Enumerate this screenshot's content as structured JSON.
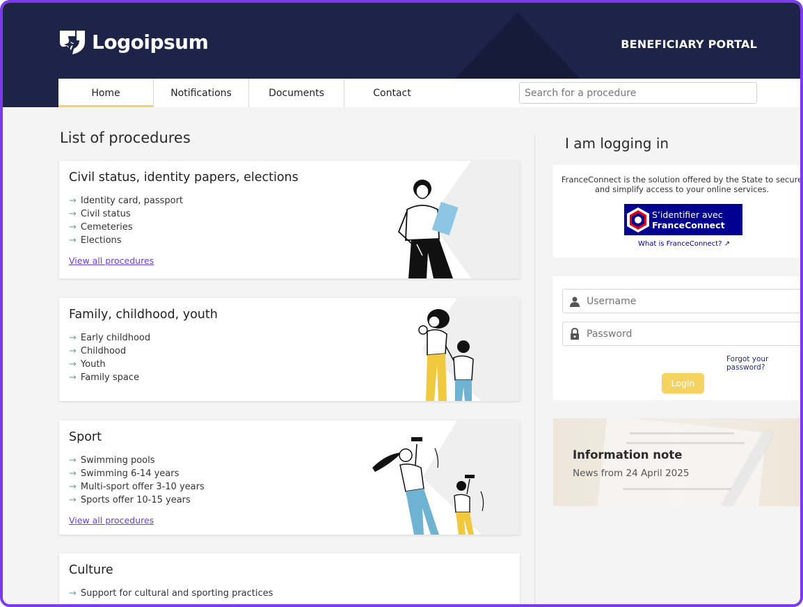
{
  "header": {
    "logo_text": "Logoipsum",
    "portal_title": "BENEFICIARY PORTAL"
  },
  "nav": {
    "tabs": [
      {
        "label": "Home",
        "active": true
      },
      {
        "label": "Notifications",
        "active": false
      },
      {
        "label": "Documents",
        "active": false
      },
      {
        "label": "Contact",
        "active": false
      }
    ],
    "search_placeholder": "Search for a procedure"
  },
  "procedures": {
    "title": "List of procedures",
    "cards": [
      {
        "title": "Civil status, identity papers, elections",
        "items": [
          "Identity card, passport",
          "Civil status",
          "Cemeteries",
          "Elections"
        ],
        "link": "View all procedures"
      },
      {
        "title": "Family, childhood, youth",
        "items": [
          "Early childhood",
          "Childhood",
          "Youth",
          "Family space"
        ],
        "link": ""
      },
      {
        "title": "Sport",
        "items": [
          "Swimming pools",
          "Swimming 6-14 years",
          "Multi-sport offer 3-10 years",
          "Sports offer 10-15 years"
        ],
        "link": "View all procedures"
      },
      {
        "title": "Culture",
        "items": [
          "Support for cultural and sporting practices"
        ],
        "link": ""
      }
    ]
  },
  "login": {
    "title": "I am logging in",
    "fc_description": "FranceConnect is the solution offered by the State to secure and simplify access to your online services.",
    "fc_button_line1": "S’identifier avec",
    "fc_button_line2": "FranceConnect",
    "fc_link": "What is FranceConnect? ↗",
    "username_placeholder": "Username",
    "password_placeholder": "Password",
    "forgot_password": "Forgot your password?",
    "login_button": "Login"
  },
  "info_note": {
    "title": "Information note",
    "subtitle": "News from 24 April 2025"
  },
  "colors": {
    "header_bg": "#1e2348",
    "accent_yellow": "#f4d35e",
    "link_purple": "#6b3fd6",
    "fc_blue": "#000091",
    "frame_border": "#7c3aed"
  },
  "icons": {
    "list_arrow": "→",
    "username": "user-icon",
    "password": "lock-icon"
  }
}
